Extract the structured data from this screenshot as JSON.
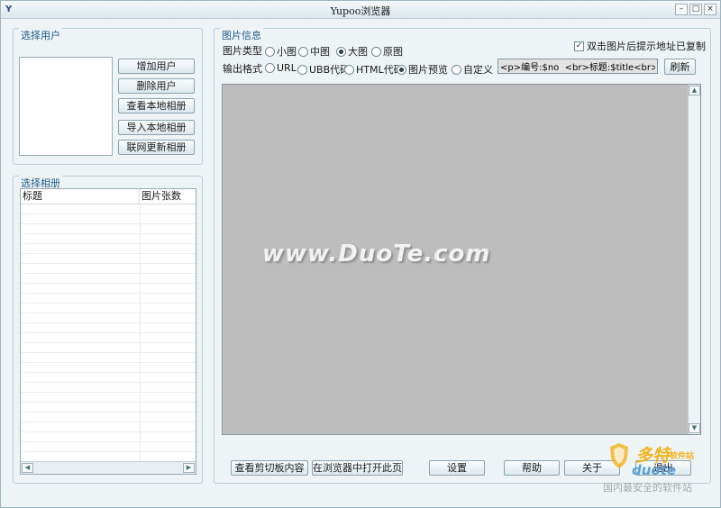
{
  "window": {
    "title": "Yupoo浏览器",
    "icon_text": "Y"
  },
  "users": {
    "legend": "选择用户",
    "buttons": {
      "add": "增加用户",
      "delete": "删除用户",
      "view_local": "查看本地相册",
      "import_local": "导入本地相册",
      "online_update": "联网更新相册"
    }
  },
  "albums": {
    "legend": "选择相册",
    "columns": [
      "标题",
      "图片张数"
    ],
    "rows": []
  },
  "image_info": {
    "legend": "图片信息",
    "type_label": "图片类型",
    "type_options": [
      "小图",
      "中图",
      "大图",
      "原图"
    ],
    "type_selected": "大图",
    "format_label": "输出格式",
    "format_options": [
      "URL",
      "UBB代码",
      "HTML代码",
      "图片预览",
      "自定义"
    ],
    "format_selected": "图片预览",
    "copy_checkbox_label": "双击图片后提示地址已复制",
    "copy_checkbox_checked": true,
    "template_value": "<p>编号:$no  <br>标题:$title<br>描述",
    "refresh_label": "刷新"
  },
  "preview": {
    "watermark": "www.DuoTe.com"
  },
  "bottom_buttons": {
    "view_clipboard": "查看剪切板内容",
    "open_browser": "在浏览器中打开此页",
    "settings": "设置",
    "help": "帮助",
    "about": "关于",
    "exit": "退出"
  },
  "logo": {
    "brand_cn": "多特",
    "brand_sub": "软件站",
    "brand_latin": "duote",
    "slogan": "国内最安全的软件站"
  },
  "colors": {
    "accent": "#1f5c8a",
    "preview_bg": "#bdbdbd",
    "logo_yellow": "#f2b21b",
    "logo_blue": "#5da0d8"
  }
}
